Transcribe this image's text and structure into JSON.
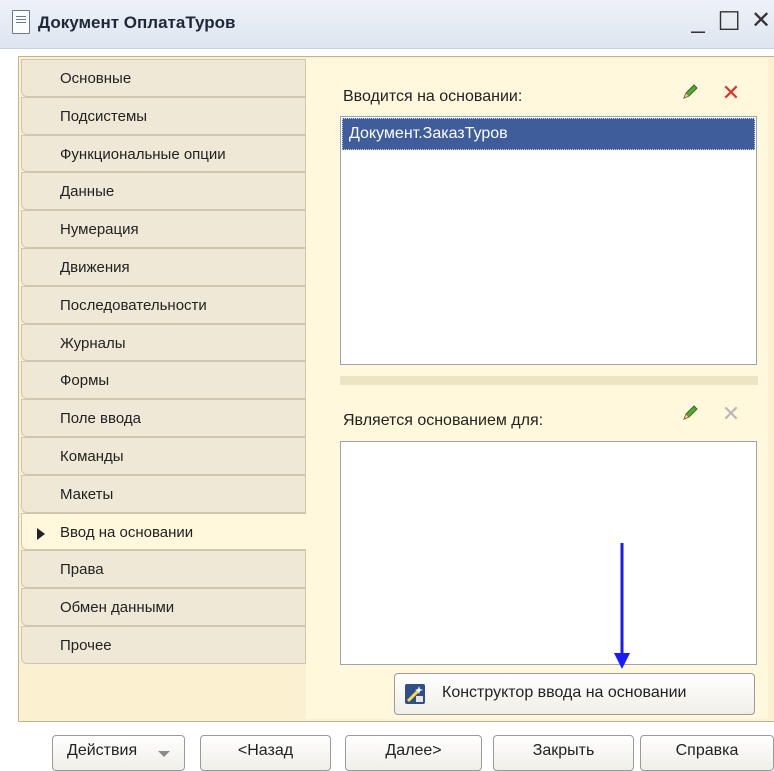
{
  "window": {
    "title": "Документ ОплатаТуров",
    "minimize": "_",
    "maximize": "☐",
    "close": "✕"
  },
  "tabs": [
    {
      "label": "Основные",
      "active": false
    },
    {
      "label": "Подсистемы",
      "active": false
    },
    {
      "label": "Функциональные опции",
      "active": false
    },
    {
      "label": "Данные",
      "active": false
    },
    {
      "label": "Нумерация",
      "active": false
    },
    {
      "label": "Движения",
      "active": false
    },
    {
      "label": "Последовательности",
      "active": false
    },
    {
      "label": "Журналы",
      "active": false
    },
    {
      "label": "Формы",
      "active": false
    },
    {
      "label": "Поле ввода",
      "active": false
    },
    {
      "label": "Команды",
      "active": false
    },
    {
      "label": "Макеты",
      "active": false
    },
    {
      "label": "Ввод на основании",
      "active": true
    },
    {
      "label": "Права",
      "active": false
    },
    {
      "label": "Обмен данными",
      "active": false
    },
    {
      "label": "Прочее",
      "active": false
    }
  ],
  "based_on": {
    "label": "Вводится на основании:",
    "items": [
      "Документ.ЗаказТуров"
    ],
    "selected_index": 0,
    "edit_icon": "pencil-icon",
    "delete_icon": "delete-icon"
  },
  "basis_for": {
    "label": "Является основанием для:",
    "items": [],
    "edit_icon": "pencil-icon",
    "delete_icon": "delete-icon-disabled"
  },
  "constructor_button": {
    "label": "Конструктор ввода на основании",
    "icon": "constructor-wand-icon"
  },
  "footer": {
    "actions": "Действия",
    "back": "<Назад",
    "next": "Далее>",
    "close": "Закрыть",
    "help": "Справка"
  },
  "colors": {
    "panel_bg": "#fbf1d1",
    "selection": "#3e5d9a",
    "annotation_arrow": "#1a1aff",
    "delete_active": "#e0302a",
    "delete_disabled": "#b8b8b8"
  }
}
